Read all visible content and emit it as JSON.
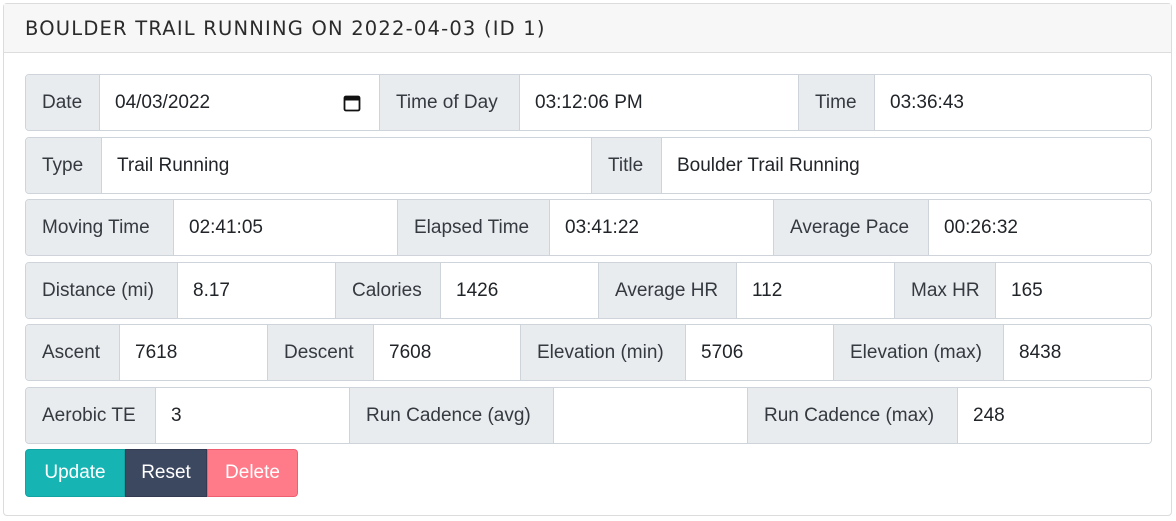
{
  "header": {
    "title": "BOULDER TRAIL RUNNING ON 2022-04-03 (ID 1)"
  },
  "rows": {
    "r1": {
      "date_label": "Date",
      "date_value": "04/03/2022",
      "tod_label": "Time of Day",
      "tod_value": "03:12:06 PM",
      "time_label": "Time",
      "time_value": "03:36:43"
    },
    "r2": {
      "type_label": "Type",
      "type_value": "Trail Running",
      "title_label": "Title",
      "title_value": "Boulder Trail Running"
    },
    "r3": {
      "moving_label": "Moving Time",
      "moving_value": "02:41:05",
      "elapsed_label": "Elapsed Time",
      "elapsed_value": "03:41:22",
      "pace_label": "Average Pace",
      "pace_value": "00:26:32"
    },
    "r4": {
      "dist_label": "Distance (mi)",
      "dist_value": "8.17",
      "cal_label": "Calories",
      "cal_value": "1426",
      "avghr_label": "Average HR",
      "avghr_value": "112",
      "maxhr_label": "Max HR",
      "maxhr_value": "165"
    },
    "r5": {
      "ascent_label": "Ascent",
      "ascent_value": "7618",
      "descent_label": "Descent",
      "descent_value": "7608",
      "elevmin_label": "Elevation (min)",
      "elevmin_value": "5706",
      "elevmax_label": "Elevation (max)",
      "elevmax_value": "8438"
    },
    "r6": {
      "te_label": "Aerobic TE",
      "te_value": "3",
      "cadavg_label": "Run Cadence (avg)",
      "cadavg_value": "",
      "cadmax_label": "Run Cadence (max)",
      "cadmax_value": "248"
    }
  },
  "buttons": {
    "update": "Update",
    "reset": "Reset",
    "delete": "Delete"
  },
  "icons": {
    "date_picker": "calendar-icon"
  },
  "colors": {
    "update": "#17b4b4",
    "reset": "#3c4760",
    "delete": "#ff7b8a",
    "label_bg": "#e9ecef"
  }
}
